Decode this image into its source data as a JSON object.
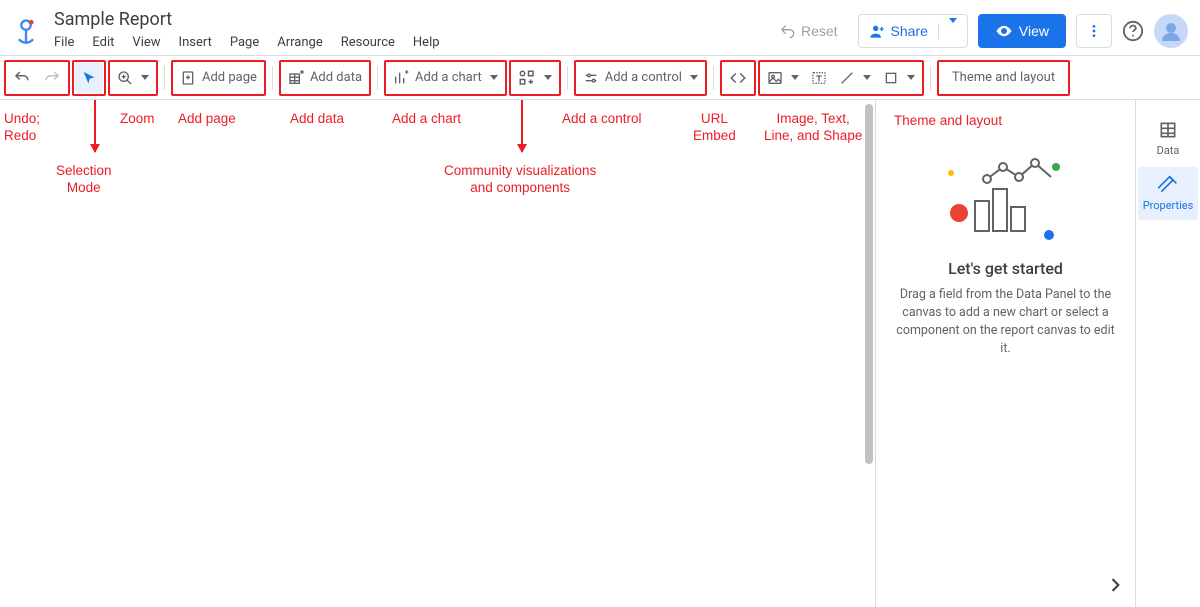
{
  "header": {
    "doc_title": "Sample Report",
    "menu": {
      "file": "File",
      "edit": "Edit",
      "view": "View",
      "insert": "Insert",
      "page": "Page",
      "arrange": "Arrange",
      "resource": "Resource",
      "help": "Help"
    },
    "actions": {
      "reset": "Reset",
      "share": "Share",
      "view": "View"
    }
  },
  "toolbar": {
    "add_page": "Add page",
    "add_data": "Add data",
    "add_chart": "Add a chart",
    "add_control": "Add a control",
    "theme_layout": "Theme and layout"
  },
  "sidepanel": {
    "title": "Let's get started",
    "body": "Drag a field from the Data Panel to the canvas to add a new chart or select a component on the report canvas to edit it."
  },
  "rail": {
    "data": "Data",
    "properties": "Properties"
  },
  "annotations": {
    "undo_redo": "Undo;\nRedo",
    "selection": "Selection\nMode",
    "zoom": "Zoom",
    "add_page": "Add page",
    "add_data": "Add data",
    "add_chart": "Add a chart",
    "community": "Community visualizations\nand components",
    "add_control": "Add a control",
    "url_embed": "URL\nEmbed",
    "image_text": "Image, Text,\nLine, and Shape",
    "theme_layout": "Theme and layout"
  }
}
